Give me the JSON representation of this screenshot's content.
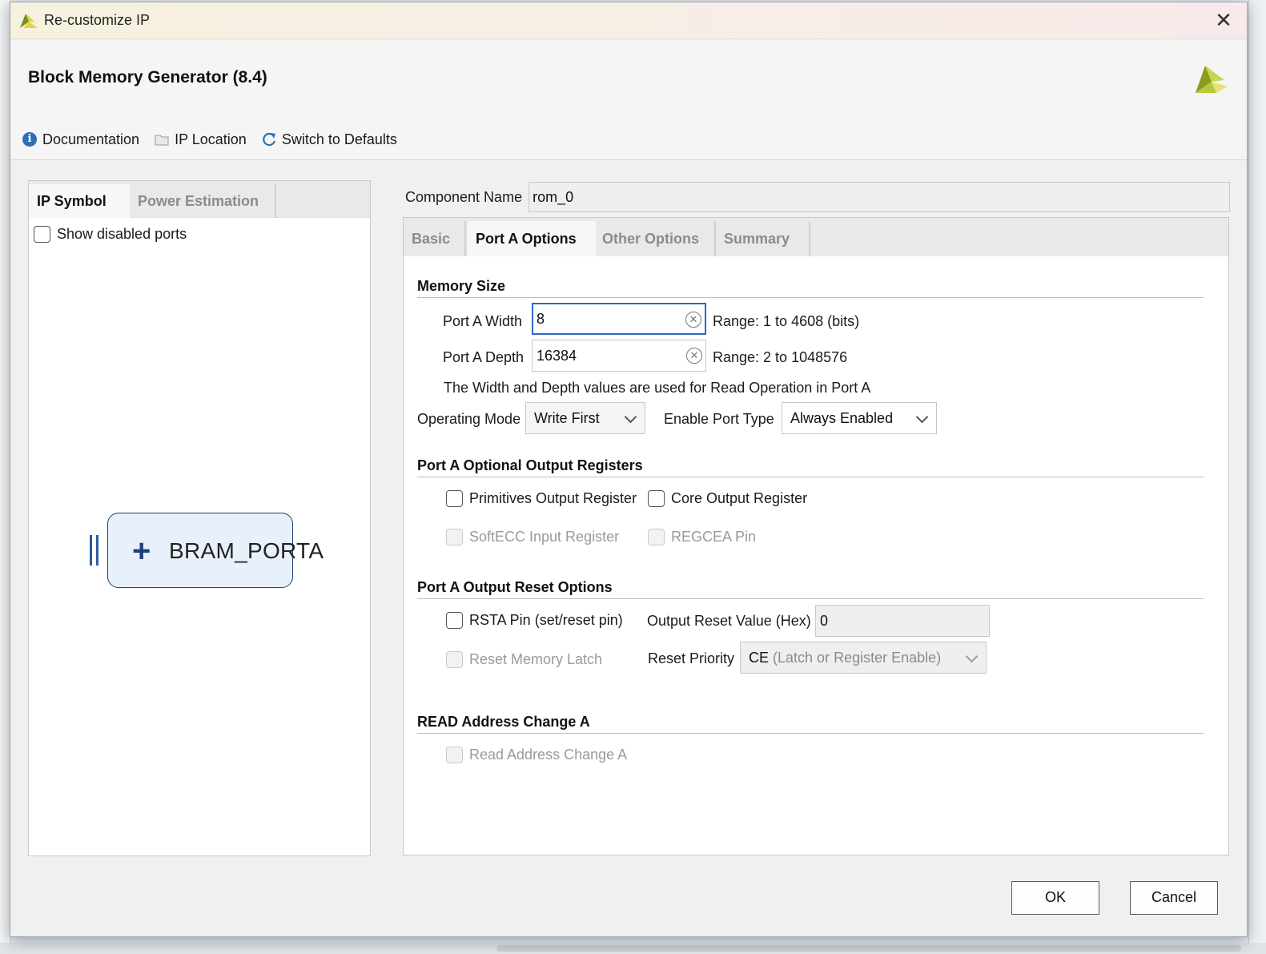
{
  "window": {
    "title": "Re-customize IP",
    "close_glyph": "✕"
  },
  "header": {
    "ip_title": "Block Memory Generator (8.4)",
    "toolbar": {
      "documentation": "Documentation",
      "ip_location": "IP Location",
      "switch_defaults": "Switch to Defaults"
    }
  },
  "left_panel": {
    "tabs": [
      "IP Symbol",
      "Power Estimation"
    ],
    "active_tab": "IP Symbol",
    "show_disabled_ports": {
      "label": "Show disabled ports",
      "checked": false
    },
    "symbol": {
      "port_label": "BRAM_PORTA"
    }
  },
  "component": {
    "label": "Component Name",
    "value": "rom_0"
  },
  "right_panel": {
    "tabs": [
      "Basic",
      "Port A Options",
      "Other Options",
      "Summary"
    ],
    "active_tab": "Port A Options",
    "memory_size": {
      "title": "Memory Size",
      "width_label": "Port A Width",
      "width_value": "8",
      "width_range": "Range: 1 to 4608 (bits)",
      "depth_label": "Port A Depth",
      "depth_value": "16384",
      "depth_range": "Range: 2 to 1048576",
      "note": "The Width and Depth values are used for Read Operation in Port A",
      "operating_mode_label": "Operating Mode",
      "operating_mode_value": "Write First",
      "enable_port_type_label": "Enable Port Type",
      "enable_port_type_value": "Always Enabled"
    },
    "optional_output_registers": {
      "title": "Port A Optional Output Registers",
      "primitives": {
        "label": "Primitives Output Register",
        "checked": false,
        "enabled": true
      },
      "core": {
        "label": "Core Output Register",
        "checked": false,
        "enabled": true
      },
      "softecc": {
        "label": "SoftECC Input Register",
        "checked": false,
        "enabled": false
      },
      "regcea": {
        "label": "REGCEA Pin",
        "checked": false,
        "enabled": false
      }
    },
    "output_reset": {
      "title": "Port A Output Reset Options",
      "rsta": {
        "label": "RSTA Pin (set/reset pin)",
        "checked": false,
        "enabled": true
      },
      "reset_value_label": "Output Reset Value (Hex)",
      "reset_value": "0",
      "reset_memory_latch": {
        "label": "Reset Memory Latch",
        "checked": false,
        "enabled": false
      },
      "reset_priority_label": "Reset Priority",
      "reset_priority_value_main": "CE",
      "reset_priority_value_detail": "(Latch or Register Enable)"
    },
    "read_address_change": {
      "title": "READ Address Change A",
      "checkbox": {
        "label": "Read Address Change A",
        "checked": false,
        "enabled": false
      }
    }
  },
  "buttons": {
    "ok": "OK",
    "cancel": "Cancel"
  },
  "colors": {
    "accent": "#2e69c2",
    "symbol_fill": "#e8f0fb",
    "symbol_stroke": "#1f3f77"
  }
}
